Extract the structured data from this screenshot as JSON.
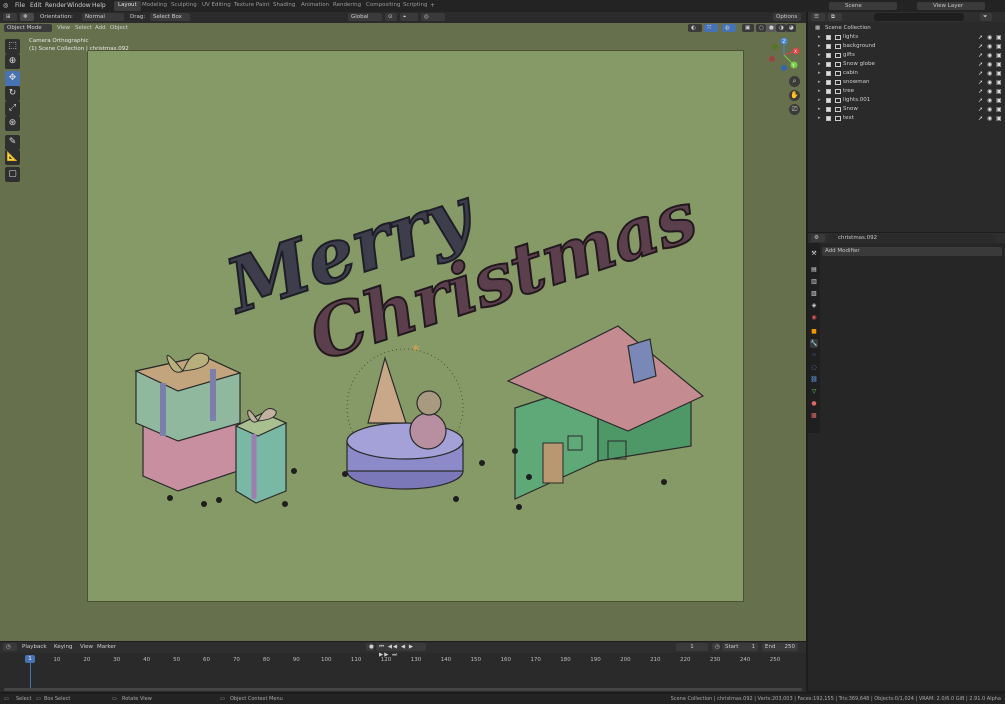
{
  "menu": [
    "File",
    "Edit",
    "Render",
    "Window",
    "Help"
  ],
  "workspaces": [
    "Layout",
    "Modeling",
    "Sculpting",
    "UV Editing",
    "Texture Paint",
    "Shading",
    "Animation",
    "Rendering",
    "Compositing",
    "Scripting"
  ],
  "scene_name": "Scene",
  "view_layer": "View Layer",
  "header": {
    "orientation_label": "Orientation:",
    "orientation_value": "Normal",
    "drag_label": "Drag:",
    "drag_value": "Select Box",
    "transform_orientation": "Global",
    "options": "Options"
  },
  "viewport_header": {
    "mode": "Object Mode",
    "view": "View",
    "select": "Select",
    "add": "Add",
    "object": "Object"
  },
  "viewport_overlay": {
    "camera_text": "Camera Orthographic",
    "collection_text": "(1) Scene Collection | christmas.092"
  },
  "artwork": {
    "line1": "Merry",
    "line2": "Christmas"
  },
  "gizmo": {
    "x": "X",
    "y": "Y",
    "z": "Z"
  },
  "outliner": {
    "root": "Scene Collection",
    "items": [
      {
        "name": "lights"
      },
      {
        "name": "background"
      },
      {
        "name": "gifts"
      },
      {
        "name": "Snow globe"
      },
      {
        "name": "cabin"
      },
      {
        "name": "snowman"
      },
      {
        "name": "tree"
      },
      {
        "name": "lights.001"
      },
      {
        "name": "Snow"
      },
      {
        "name": "text"
      }
    ]
  },
  "properties": {
    "object_name": "christmas.092",
    "add_modifier": "Add Modifier"
  },
  "timeline": {
    "menu": [
      "Playback",
      "Keying",
      "View",
      "Marker"
    ],
    "current_frame": "1",
    "start_label": "Start",
    "start_value": "1",
    "end_label": "End",
    "end_value": "250",
    "ticks": [
      "1",
      "10",
      "20",
      "30",
      "40",
      "50",
      "60",
      "70",
      "80",
      "90",
      "100",
      "110",
      "120",
      "130",
      "140",
      "150",
      "160",
      "170",
      "180",
      "190",
      "200",
      "210",
      "220",
      "230",
      "240",
      "250"
    ]
  },
  "statusbar": {
    "select": "Select",
    "box_select": "Box Select",
    "rotate_view": "Rotate View",
    "context_menu": "Object Context Menu",
    "stats": "Scene Collection | christmas.092 | Verts:203,003 | Faces:192,155 | Tris:369,648 | Objects:0/1,024 | VRAM: 2.0/6.0 GiB | 2.91.0 Alpha"
  }
}
